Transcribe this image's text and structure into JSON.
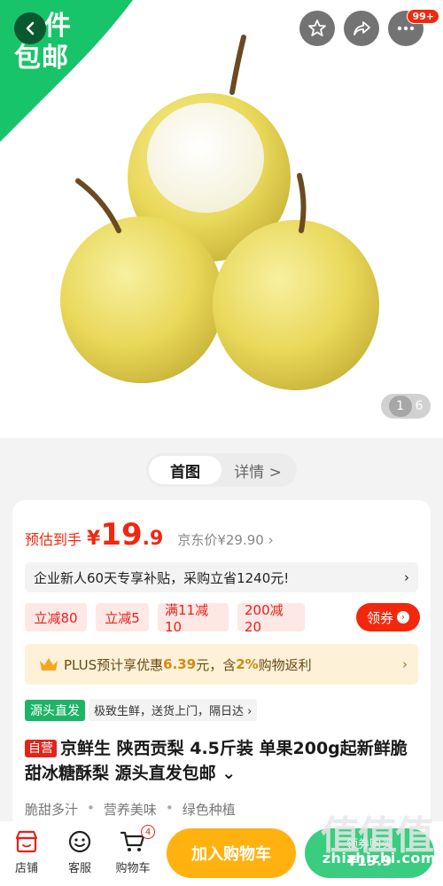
{
  "hero": {
    "free_ship_line1": "件",
    "free_ship_line2": "包邮",
    "badge_count": "99+",
    "pager_current": "1",
    "pager_total": "6"
  },
  "tabs": [
    {
      "label": "首图"
    },
    {
      "label": "详情 >"
    }
  ],
  "price": {
    "label": "预估到手",
    "symbol": "¥",
    "integer": "19",
    "decimal": ".9",
    "jd_price": "京东价¥29.90 ›",
    "accent_color": "#f2270c"
  },
  "subsidy": {
    "text": "企业新人60天专享补贴，采购立省1240元!",
    "arrow": "›"
  },
  "coupons": [
    {
      "label": "立减80"
    },
    {
      "label": "立减5"
    },
    {
      "label": "满11减10"
    },
    {
      "label": "200减20"
    }
  ],
  "get_coupon": {
    "label": "领券",
    "arrow": "›"
  },
  "plus": {
    "prefix": "PLUS预计享优惠",
    "amount": "6.39",
    "middle": "元，含",
    "rebate": "2%",
    "suffix": "购物返利",
    "arrow": "›",
    "icon": "crown-icon"
  },
  "origin": {
    "tag": "源头直发",
    "text": "极致生鲜，送货上门，隔日达 ›"
  },
  "title": {
    "self_tag": "自营",
    "text": "京鲜生 陕西贡梨 4.5斤装 单果200g起新鲜脆甜冰糖酥梨 源头直发包邮 ⌄"
  },
  "features": [
    "脆甜多汁",
    "营养美味",
    "绿色种植"
  ],
  "bottom": {
    "store": "店铺",
    "service": "客服",
    "cart": "购物车",
    "cart_count": "4",
    "add_cart": "加入购物车",
    "buy_now": "领券购买",
    "buy_price": "¥19.9",
    "watermark": "zhizhizhi.com",
    "watermark_logo": "值值值"
  }
}
